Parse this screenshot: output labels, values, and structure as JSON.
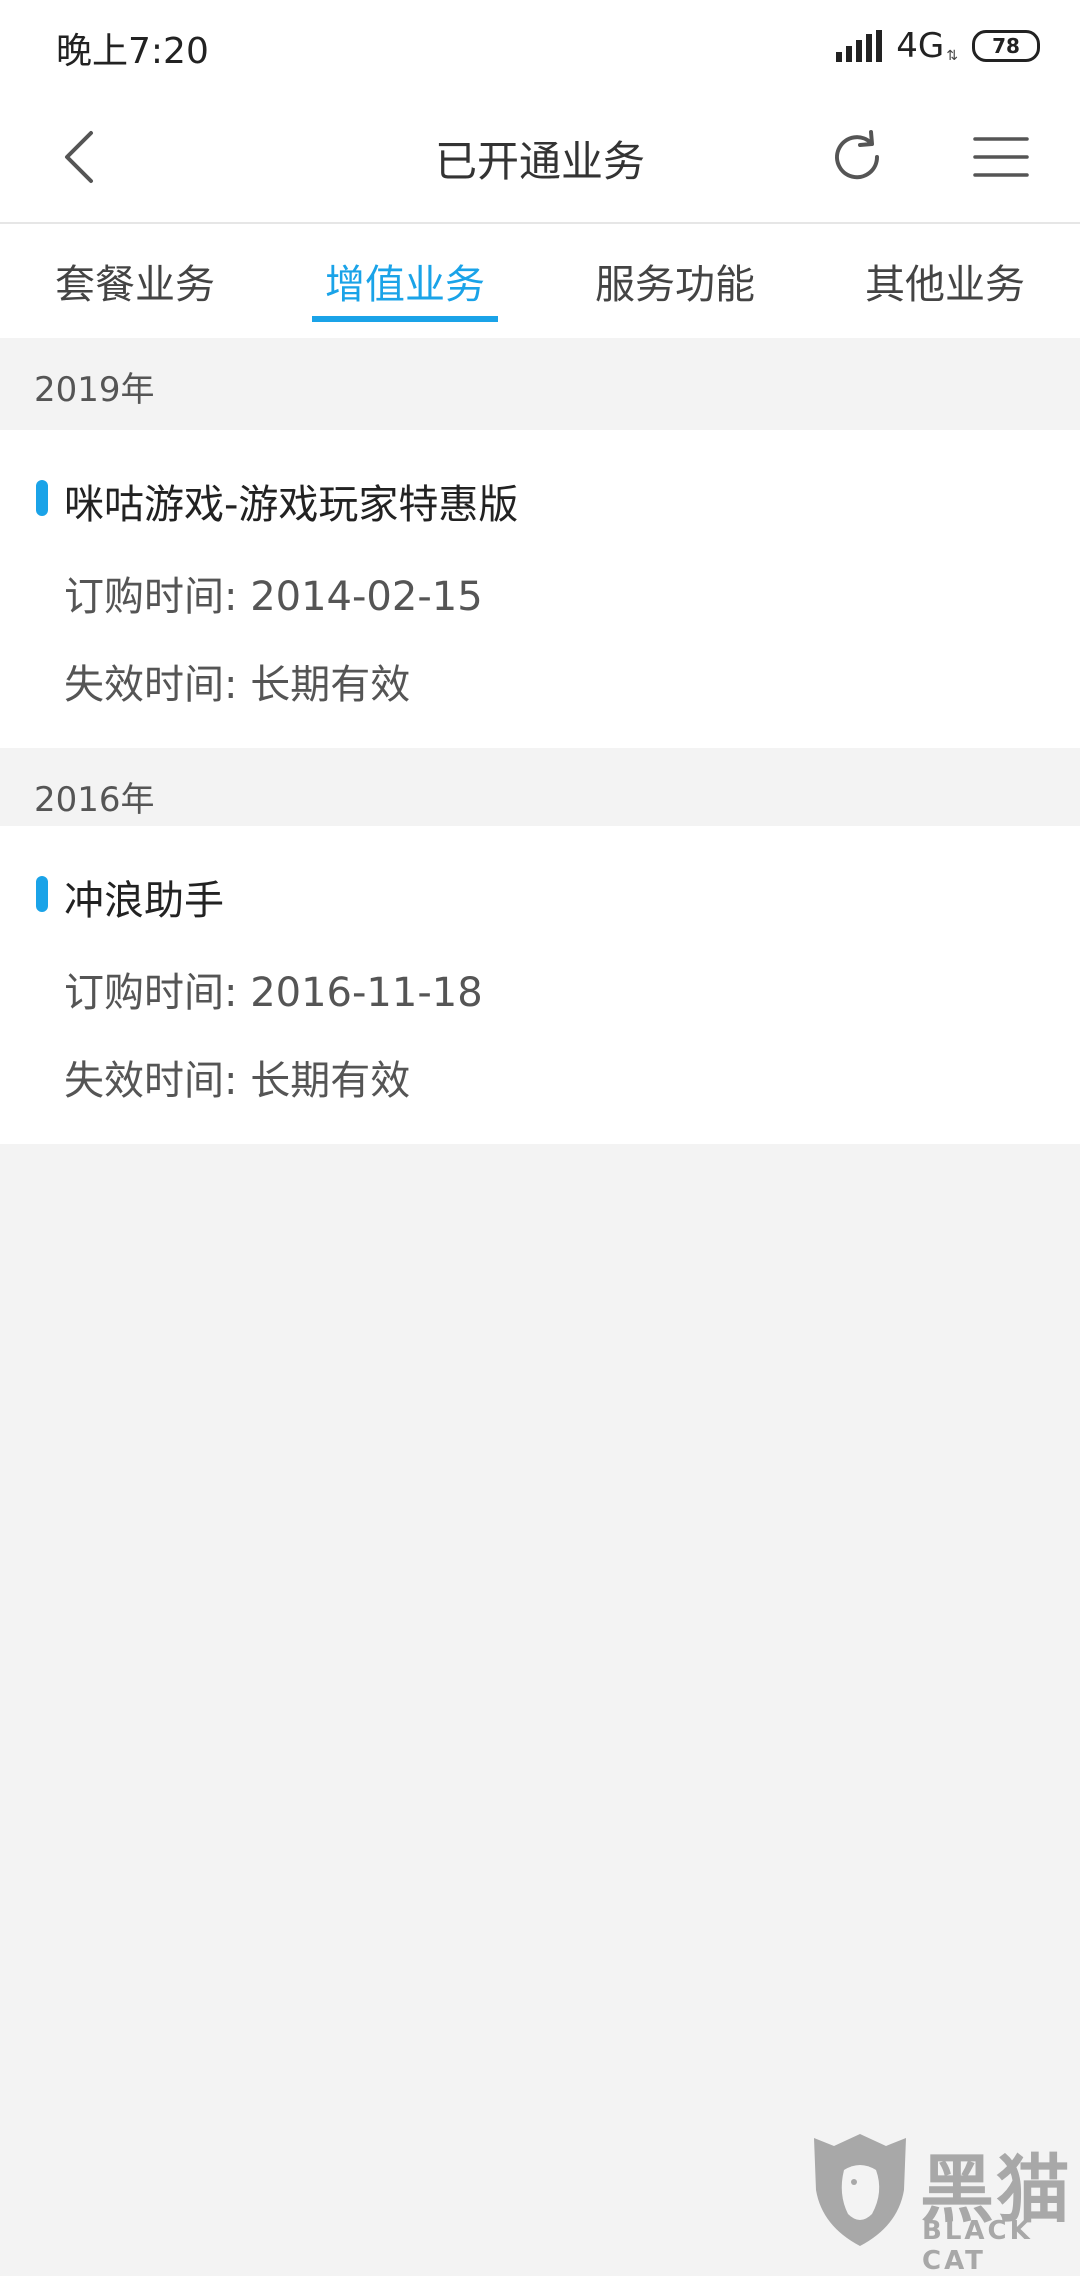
{
  "status_bar": {
    "time": "晚上7:20",
    "network": "4G",
    "battery": "78"
  },
  "header": {
    "title": "已开通业务"
  },
  "tabs": [
    {
      "label": "套餐业务",
      "active": false
    },
    {
      "label": "增值业务",
      "active": true
    },
    {
      "label": "服务功能",
      "active": false
    },
    {
      "label": "其他业务",
      "active": false
    }
  ],
  "sections": [
    {
      "year": "2019年",
      "items": [
        {
          "name": "咪咕游戏-游戏玩家特惠版",
          "order_time": "订购时间: 2014-02-15",
          "expire_time": "失效时间: 长期有效"
        }
      ]
    },
    {
      "year": "2016年",
      "items": [
        {
          "name": "冲浪助手",
          "order_time": "订购时间: 2016-11-18",
          "expire_time": "失效时间: 长期有效"
        }
      ]
    }
  ],
  "watermark": {
    "text": "黑猫",
    "sub": "BLACK CAT"
  },
  "colors": {
    "accent": "#1aa3e8",
    "background": "#f3f3f3",
    "card": "#ffffff"
  },
  "icons": {
    "back": "chevron-left-icon",
    "refresh": "refresh-icon",
    "menu": "hamburger-menu-icon"
  }
}
